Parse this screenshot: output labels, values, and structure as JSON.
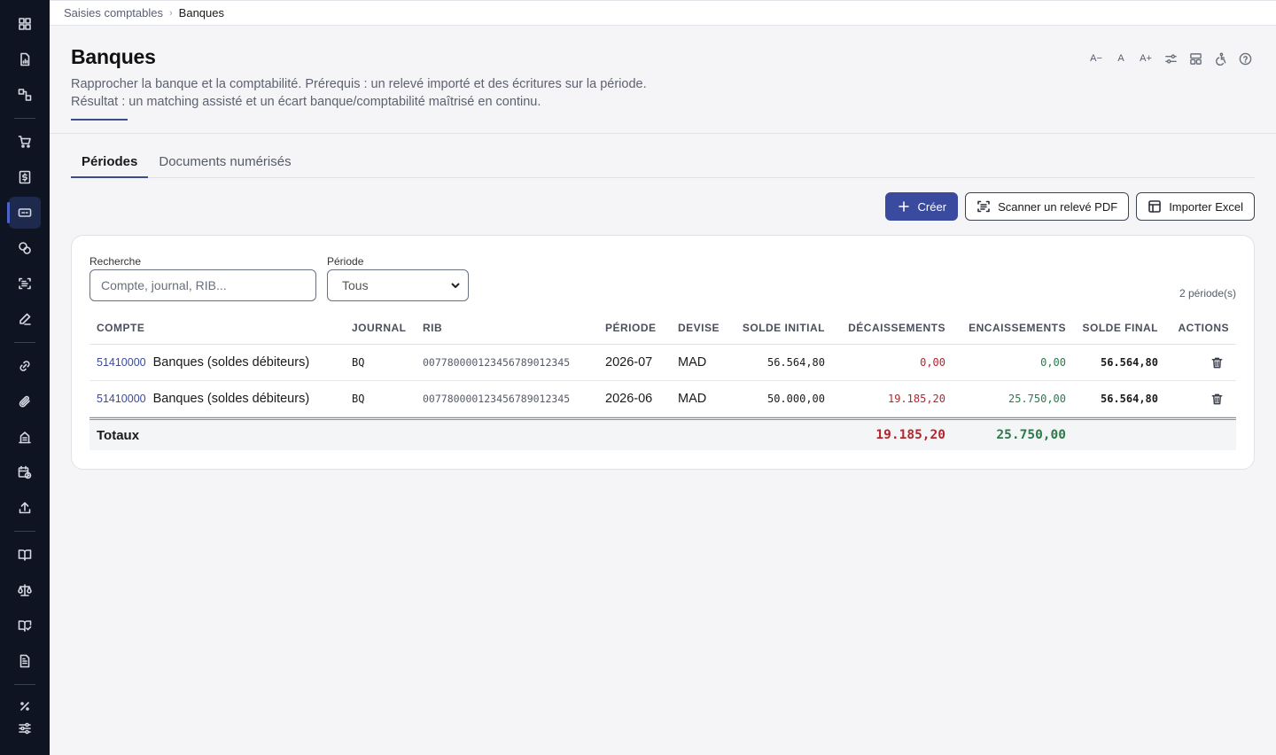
{
  "breadcrumb": {
    "parent": "Saisies comptables",
    "current": "Banques"
  },
  "header": {
    "title": "Banques",
    "description_line1": "Rapprocher la banque et la comptabilité. Prérequis : un relevé importé et des écritures sur la période.",
    "description_line2": "Résultat : un matching assisté et un écart banque/comptabilité maîtrisé en continu."
  },
  "toolbar": {
    "font_decrease": "A−",
    "font_reset": "A",
    "font_increase": "A+"
  },
  "tabs": [
    {
      "label": "Périodes",
      "active": true
    },
    {
      "label": "Documents numérisés",
      "active": false
    }
  ],
  "actions": {
    "create_label": "Créer",
    "scan_label": "Scanner un relevé PDF",
    "import_label": "Importer Excel"
  },
  "filters": {
    "search_label": "Recherche",
    "search_placeholder": "Compte, journal, RIB...",
    "period_label": "Période",
    "period_value": "Tous"
  },
  "count_text": "2 période(s)",
  "table": {
    "headers": {
      "compte": "COMPTE",
      "journal": "JOURNAL",
      "rib": "RIB",
      "periode": "PÉRIODE",
      "devise": "DEVISE",
      "solde_initial": "SOLDE INITIAL",
      "decaissements": "DÉCAISSEMENTS",
      "encaissements": "ENCAISSEMENTS",
      "solde_final": "SOLDE FINAL",
      "actions": "ACTIONS"
    },
    "rows": [
      {
        "account_code": "51410000",
        "account_name": "Banques (soldes débiteurs)",
        "journal": "BQ",
        "rib": "007780000123456789012345",
        "periode": "2026-07",
        "devise": "MAD",
        "solde_initial": "56.564,80",
        "decaissements": "0,00",
        "encaissements": "0,00",
        "solde_final": "56.564,80"
      },
      {
        "account_code": "51410000",
        "account_name": "Banques (soldes débiteurs)",
        "journal": "BQ",
        "rib": "007780000123456789012345",
        "periode": "2026-06",
        "devise": "MAD",
        "solde_initial": "50.000,00",
        "decaissements": "19.185,20",
        "encaissements": "25.750,00",
        "solde_final": "56.564,80"
      }
    ],
    "totals": {
      "label": "Totaux",
      "decaissements": "19.185,20",
      "encaissements": "25.750,00"
    }
  },
  "colors": {
    "sidebar_bg": "#0f1422",
    "primary": "#3a4a9e",
    "negative": "#b3262e",
    "positive": "#2a7a4a"
  }
}
